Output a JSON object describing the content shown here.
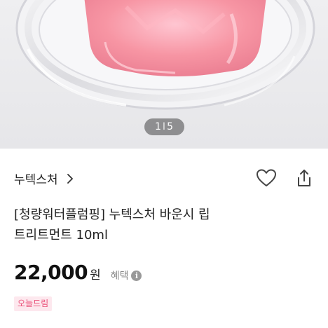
{
  "gallery": {
    "current_page": "1",
    "total_pages": "5",
    "separator": "I"
  },
  "brand": {
    "name": "누텍스처",
    "chevron_icon": "chevron-right-icon"
  },
  "actions": {
    "wishlist_icon": "heart-icon",
    "share_icon": "share-icon"
  },
  "product": {
    "title_line1": "[청량워터플럼핑] 누텍스처 바운시 립",
    "title_line2": "트리트먼트 10ml",
    "price": "22,000",
    "currency": "원",
    "benefit_label": "혜택",
    "info_icon": "info-icon",
    "badge": "오늘드림"
  },
  "colors": {
    "badge_text": "#ea4f78",
    "badge_bg": "#fde8ee",
    "product_pink": "#f58aa0"
  }
}
